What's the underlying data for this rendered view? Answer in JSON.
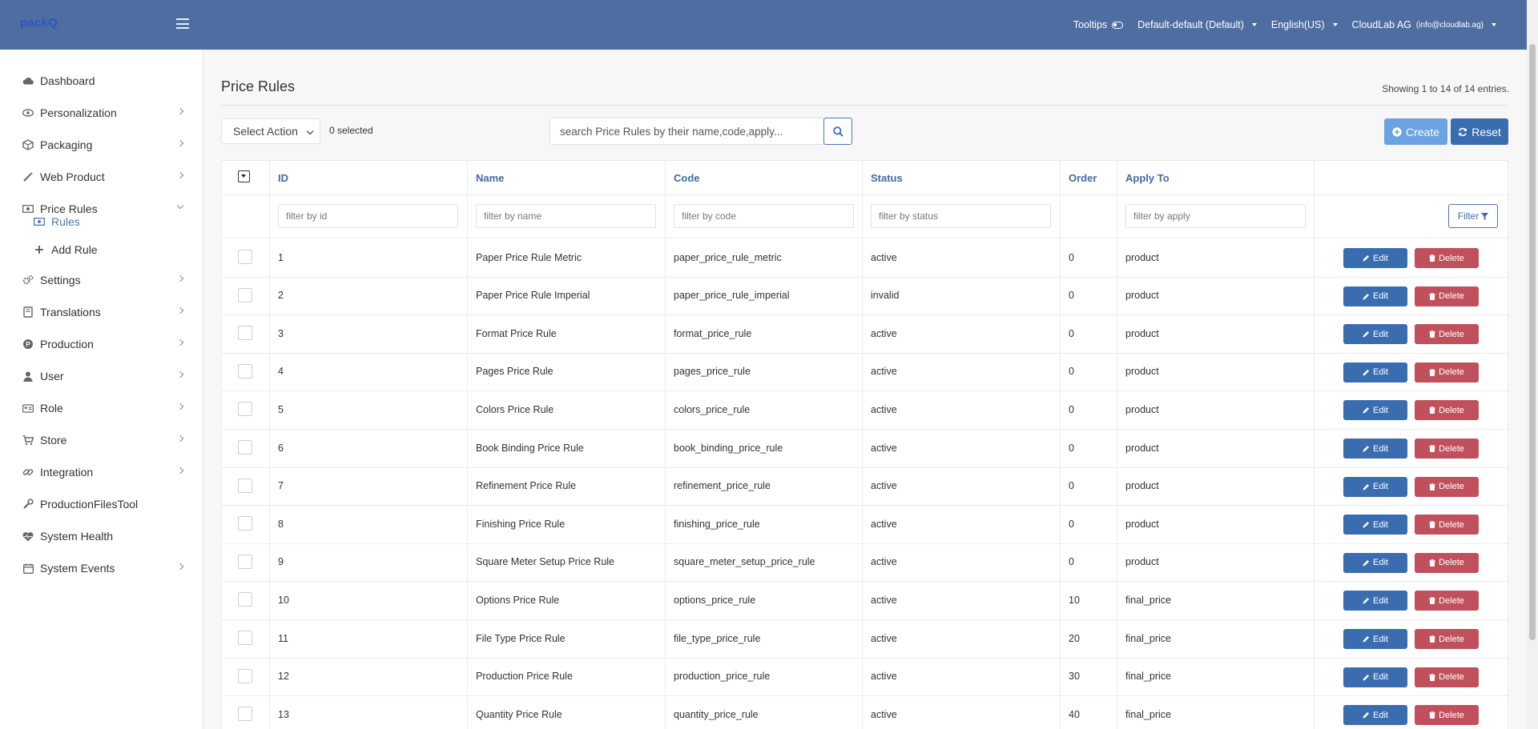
{
  "app": {
    "logo": "packQ"
  },
  "topbar": {
    "tooltips_label": "Tooltips",
    "store_label": "Default-default (Default)",
    "language_label": "English(US)",
    "account_label": "CloudLab AG",
    "account_email": "(info@cloudlab.ag)"
  },
  "sidebar": {
    "items": [
      {
        "label": "Dashboard",
        "icon": "cloud-icon"
      },
      {
        "label": "Personalization",
        "icon": "eye-icon"
      },
      {
        "label": "Packaging",
        "icon": "box-icon"
      },
      {
        "label": "Web Product",
        "icon": "wand-icon"
      },
      {
        "label": "Price Rules",
        "icon": "money-icon"
      },
      {
        "label": "Settings",
        "icon": "gears-icon"
      },
      {
        "label": "Translations",
        "icon": "book-icon"
      },
      {
        "label": "Production",
        "icon": "production-icon"
      },
      {
        "label": "User",
        "icon": "user-icon"
      },
      {
        "label": "Role",
        "icon": "id-card-icon"
      },
      {
        "label": "Store",
        "icon": "cart-icon"
      },
      {
        "label": "Integration",
        "icon": "link-icon"
      },
      {
        "label": "ProductionFilesTool",
        "icon": "wrench-icon"
      },
      {
        "label": "System Health",
        "icon": "heartbeat-icon"
      },
      {
        "label": "System Events",
        "icon": "calendar-icon"
      }
    ],
    "sub_items": [
      {
        "label": "Rules",
        "icon": "money-icon"
      },
      {
        "label": "Add Rule",
        "icon": "plus-icon"
      }
    ]
  },
  "page": {
    "title": "Price Rules",
    "showing": "Showing 1 to 14 of 14 entries.",
    "select_action": "Select Action",
    "selected_count": "0 selected",
    "search_placeholder": "search Price Rules by their name,code,apply...",
    "create_label": "Create",
    "reset_label": "Reset"
  },
  "table": {
    "headers": [
      "ID",
      "Name",
      "Code",
      "Status",
      "Order",
      "Apply To"
    ],
    "filters": {
      "id": "filter by id",
      "name": "filter by name",
      "code": "filter by code",
      "status": "filter by status",
      "apply": "filter by apply",
      "button": "Filter"
    },
    "edit_label": "Edit",
    "delete_label": "Delete",
    "rows": [
      {
        "id": "1",
        "name": "Paper Price Rule Metric",
        "code": "paper_price_rule_metric",
        "status": "active",
        "order": "0",
        "apply": "product"
      },
      {
        "id": "2",
        "name": "Paper Price Rule Imperial",
        "code": "paper_price_rule_imperial",
        "status": "invalid",
        "order": "0",
        "apply": "product"
      },
      {
        "id": "3",
        "name": "Format Price Rule",
        "code": "format_price_rule",
        "status": "active",
        "order": "0",
        "apply": "product"
      },
      {
        "id": "4",
        "name": "Pages Price Rule",
        "code": "pages_price_rule",
        "status": "active",
        "order": "0",
        "apply": "product"
      },
      {
        "id": "5",
        "name": "Colors Price Rule",
        "code": "colors_price_rule",
        "status": "active",
        "order": "0",
        "apply": "product"
      },
      {
        "id": "6",
        "name": "Book Binding Price Rule",
        "code": "book_binding_price_rule",
        "status": "active",
        "order": "0",
        "apply": "product"
      },
      {
        "id": "7",
        "name": "Refinement Price Rule",
        "code": "refinement_price_rule",
        "status": "active",
        "order": "0",
        "apply": "product"
      },
      {
        "id": "8",
        "name": "Finishing Price Rule",
        "code": "finishing_price_rule",
        "status": "active",
        "order": "0",
        "apply": "product"
      },
      {
        "id": "9",
        "name": "Square Meter Setup Price Rule",
        "code": "square_meter_setup_price_rule",
        "status": "active",
        "order": "0",
        "apply": "product"
      },
      {
        "id": "10",
        "name": "Options Price Rule",
        "code": "options_price_rule",
        "status": "active",
        "order": "10",
        "apply": "final_price"
      },
      {
        "id": "11",
        "name": "File Type Price Rule",
        "code": "file_type_price_rule",
        "status": "active",
        "order": "20",
        "apply": "final_price"
      },
      {
        "id": "12",
        "name": "Production Price Rule",
        "code": "production_price_rule",
        "status": "active",
        "order": "30",
        "apply": "final_price"
      },
      {
        "id": "13",
        "name": "Quantity Price Rule",
        "code": "quantity_price_rule",
        "status": "active",
        "order": "40",
        "apply": "final_price"
      }
    ]
  }
}
